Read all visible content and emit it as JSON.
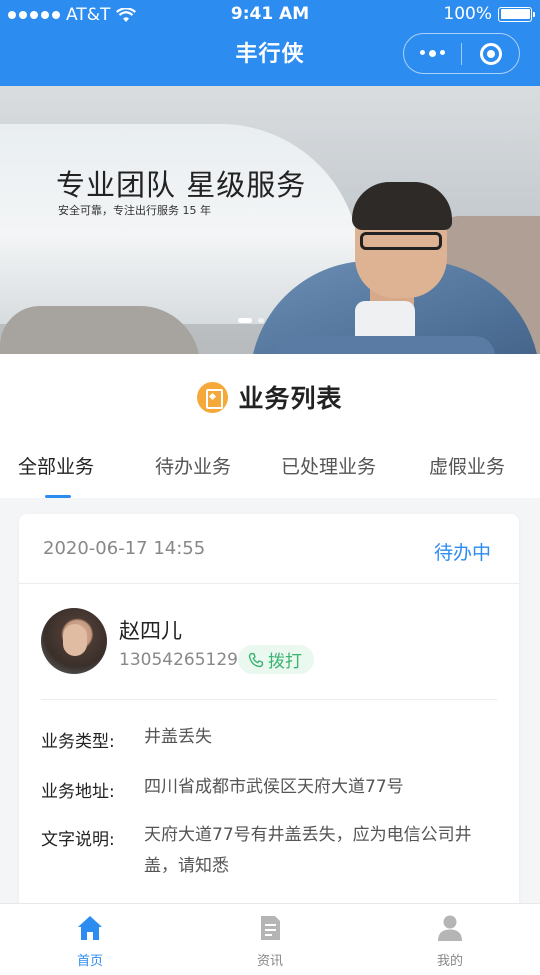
{
  "status_bar": {
    "carrier": "AT&T",
    "time": "9:41 AM",
    "battery": "100%"
  },
  "nav": {
    "title": "丰行侠"
  },
  "banner": {
    "headline": "专业团队 星级服务",
    "subline": "安全可靠，专注出行服务 15 年",
    "slides": 2,
    "active_slide": 1
  },
  "section": {
    "title": "业务列表",
    "icon": "badge-icon"
  },
  "tabs": [
    {
      "label": "全部业务",
      "active": true
    },
    {
      "label": "待办业务",
      "active": false
    },
    {
      "label": "已处理业务",
      "active": false
    },
    {
      "label": "虚假业务",
      "active": false
    }
  ],
  "card": {
    "time": "2020-06-17 14:55",
    "status": "待办中",
    "contact": {
      "name": "赵四儿",
      "phone": "13054265129",
      "call_label": "拨打"
    },
    "fields": [
      {
        "label": "业务类型:",
        "value": "井盖丢失"
      },
      {
        "label": "业务地址:",
        "value": "四川省成都市武侯区天府大道77号"
      },
      {
        "label": "文字说明:",
        "value": "天府大道77号有井盖丢失，应为电信公司井盖，请知悉"
      }
    ]
  },
  "tabbar": [
    {
      "label": "首页",
      "icon": "home-icon",
      "active": true
    },
    {
      "label": "资讯",
      "icon": "news-icon",
      "active": false
    },
    {
      "label": "我的",
      "icon": "user-icon",
      "active": false
    }
  ],
  "colors": {
    "primary": "#2d8cf0",
    "call_green": "#3cb371",
    "badge_orange": "#f6a93b"
  }
}
